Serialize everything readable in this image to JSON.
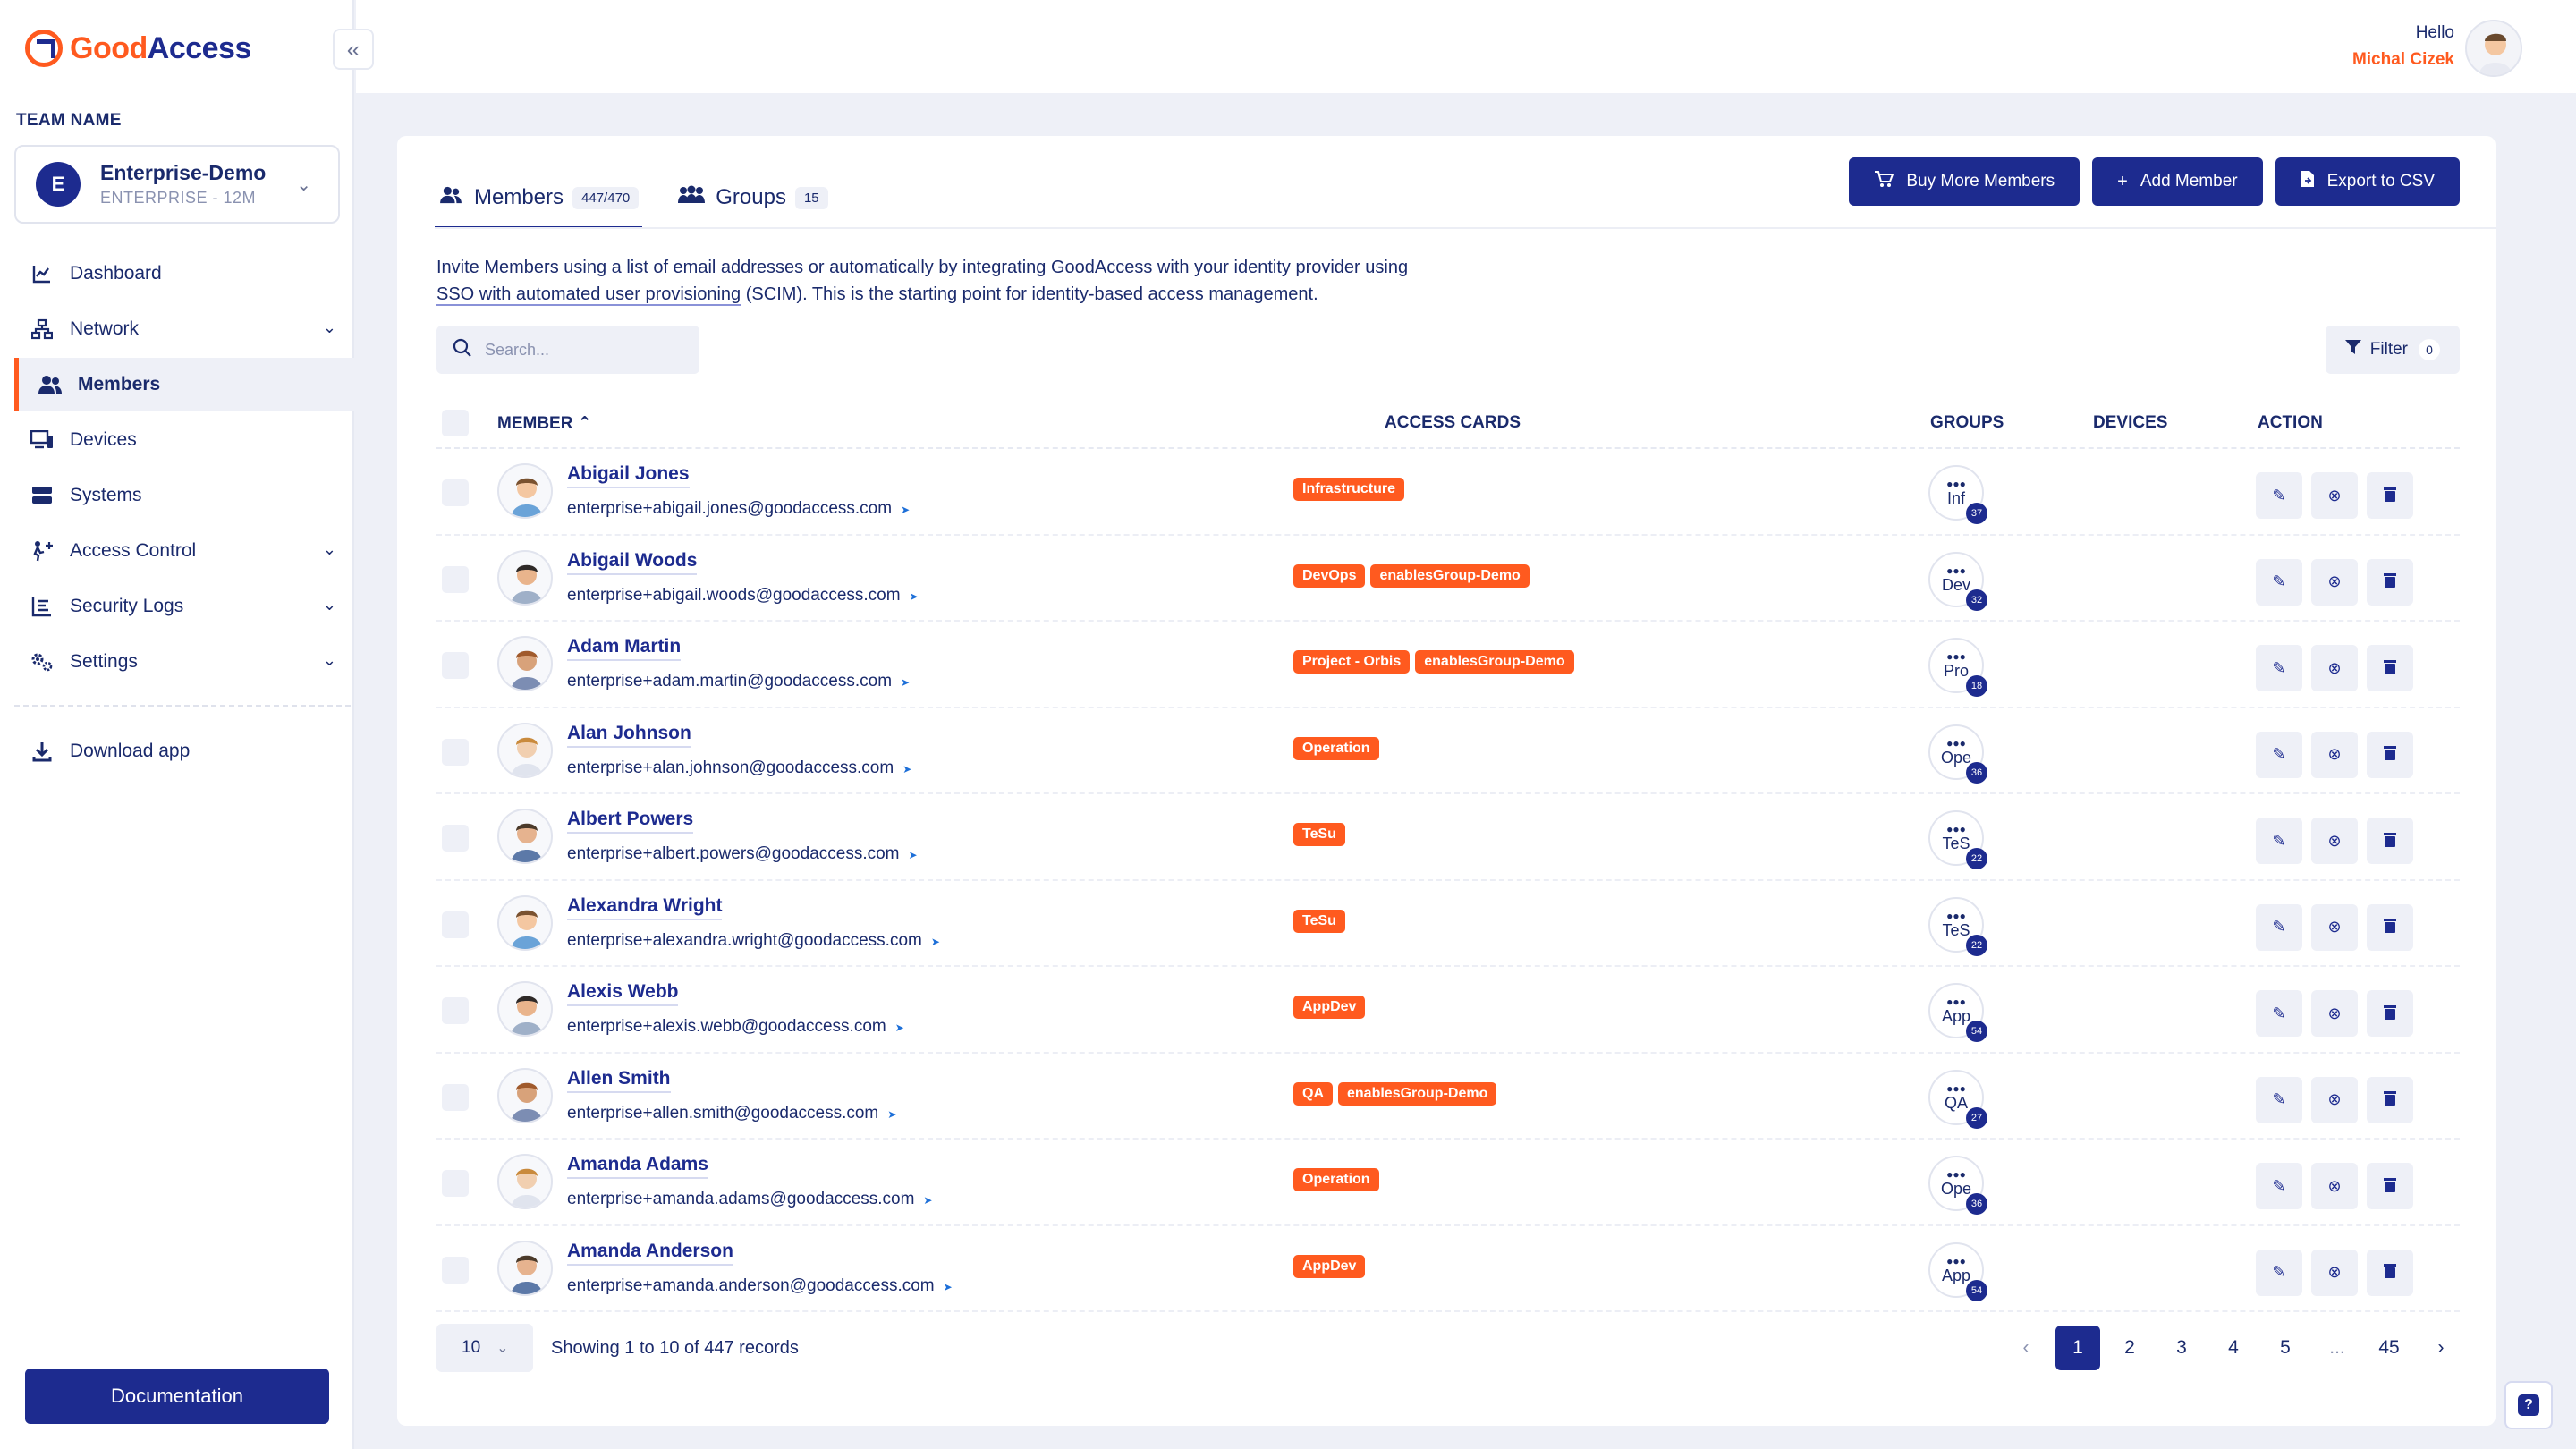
{
  "brand": {
    "part1": "Good",
    "part2": "Access",
    "accent": "#ff5a1f",
    "primary": "#1d2b8f"
  },
  "sidebar": {
    "team_label": "TEAM NAME",
    "team": {
      "initial": "E",
      "name": "Enterprise-Demo",
      "plan": "ENTERPRISE - 12M"
    },
    "items": [
      {
        "label": "Dashboard",
        "icon": "chart-line-icon"
      },
      {
        "label": "Network",
        "icon": "network-icon"
      },
      {
        "label": "Members",
        "icon": "users-icon"
      },
      {
        "label": "Devices",
        "icon": "devices-icon"
      },
      {
        "label": "Systems",
        "icon": "server-icon"
      },
      {
        "label": "Access Control",
        "icon": "access-control-icon"
      },
      {
        "label": "Security Logs",
        "icon": "logs-icon"
      },
      {
        "label": "Settings",
        "icon": "gears-icon"
      }
    ],
    "download": "Download app",
    "documentation": "Documentation"
  },
  "topbar": {
    "greeting": "Hello",
    "user": "Michal Cizek"
  },
  "tabs": [
    {
      "label": "Members",
      "count": "447/470"
    },
    {
      "label": "Groups",
      "count": "15"
    }
  ],
  "actions": {
    "buy": "Buy More Members",
    "add": "Add Member",
    "export": "Export to CSV"
  },
  "intro": {
    "text1": "Invite Members using a list of email addresses or automatically by integrating GoodAccess with your identity provider using",
    "link": "SSO with automated user provisioning",
    "text2": " (SCIM). This is the starting point for identity-based access management."
  },
  "search": {
    "placeholder": "Search..."
  },
  "filter": {
    "label": "Filter",
    "count": "0"
  },
  "columns": {
    "member": "MEMBER",
    "access_cards": "ACCESS CARDS",
    "groups": "GROUPS",
    "devices": "DEVICES",
    "action": "ACTION"
  },
  "members": [
    {
      "name": "Abigail Jones",
      "email": "enterprise+abigail.jones@goodaccess.com",
      "cards": [
        "Infrastructure"
      ],
      "group": "Inf",
      "group_count": "37"
    },
    {
      "name": "Abigail Woods",
      "email": "enterprise+abigail.woods@goodaccess.com",
      "cards": [
        "DevOps",
        "enablesGroup-Demo"
      ],
      "group": "Dev",
      "group_count": "32"
    },
    {
      "name": "Adam Martin",
      "email": "enterprise+adam.martin@goodaccess.com",
      "cards": [
        "Project - Orbis",
        "enablesGroup-Demo"
      ],
      "group": "Pro",
      "group_count": "18"
    },
    {
      "name": "Alan Johnson",
      "email": "enterprise+alan.johnson@goodaccess.com",
      "cards": [
        "Operation"
      ],
      "group": "Ope",
      "group_count": "36"
    },
    {
      "name": "Albert Powers",
      "email": "enterprise+albert.powers@goodaccess.com",
      "cards": [
        "TeSu"
      ],
      "group": "TeS",
      "group_count": "22"
    },
    {
      "name": "Alexandra Wright",
      "email": "enterprise+alexandra.wright@goodaccess.com",
      "cards": [
        "TeSu"
      ],
      "group": "TeS",
      "group_count": "22"
    },
    {
      "name": "Alexis Webb",
      "email": "enterprise+alexis.webb@goodaccess.com",
      "cards": [
        "AppDev"
      ],
      "group": "App",
      "group_count": "54"
    },
    {
      "name": "Allen Smith",
      "email": "enterprise+allen.smith@goodaccess.com",
      "cards": [
        "QA",
        "enablesGroup-Demo"
      ],
      "group": "QA",
      "group_count": "27"
    },
    {
      "name": "Amanda Adams",
      "email": "enterprise+amanda.adams@goodaccess.com",
      "cards": [
        "Operation"
      ],
      "group": "Ope",
      "group_count": "36"
    },
    {
      "name": "Amanda Anderson",
      "email": "enterprise+amanda.anderson@goodaccess.com",
      "cards": [
        "AppDev"
      ],
      "group": "App",
      "group_count": "54"
    }
  ],
  "pagination": {
    "per_page": "10",
    "showing": "Showing 1 to 10 of 447 records",
    "pages": [
      "1",
      "2",
      "3",
      "4",
      "5",
      "...",
      "45"
    ],
    "current": "1"
  }
}
